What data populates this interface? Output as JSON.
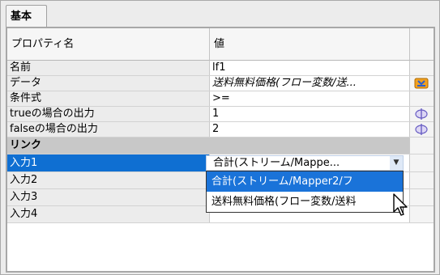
{
  "tab": {
    "label": "基本"
  },
  "table": {
    "headers": {
      "name": "プロパティ名",
      "value": "値"
    },
    "rows": [
      {
        "name": "名前",
        "value": "lf1",
        "italic": false,
        "button": ""
      },
      {
        "name": "データ",
        "value": "送料無料価格(フロー変数/送...",
        "italic": true,
        "button": "data-picker-icon"
      },
      {
        "name": "条件式",
        "value": ">=",
        "italic": false,
        "button": ""
      },
      {
        "name": "trueの場合の出力",
        "value": "1",
        "italic": false,
        "button": "expression-icon"
      },
      {
        "name": "falseの場合の出力",
        "value": "2",
        "italic": false,
        "button": "expression-icon"
      }
    ],
    "section": {
      "label": "リンク"
    },
    "link_rows": [
      {
        "name": "入力1"
      },
      {
        "name": "入力2"
      },
      {
        "name": "入力3"
      },
      {
        "name": "入力4"
      }
    ]
  },
  "combo": {
    "value": "合計(ストリーム/Mappe..."
  },
  "dropdown": {
    "options": [
      {
        "label": "合計(ストリーム/Mapper2/フ",
        "highlighted": true
      },
      {
        "label": "送料無料価格(フロー変数/送料",
        "highlighted": false
      }
    ]
  },
  "colors": {
    "selection": "#0f6fd2",
    "highlight": "#1a73d9",
    "section_bg": "#c8c8c8"
  }
}
